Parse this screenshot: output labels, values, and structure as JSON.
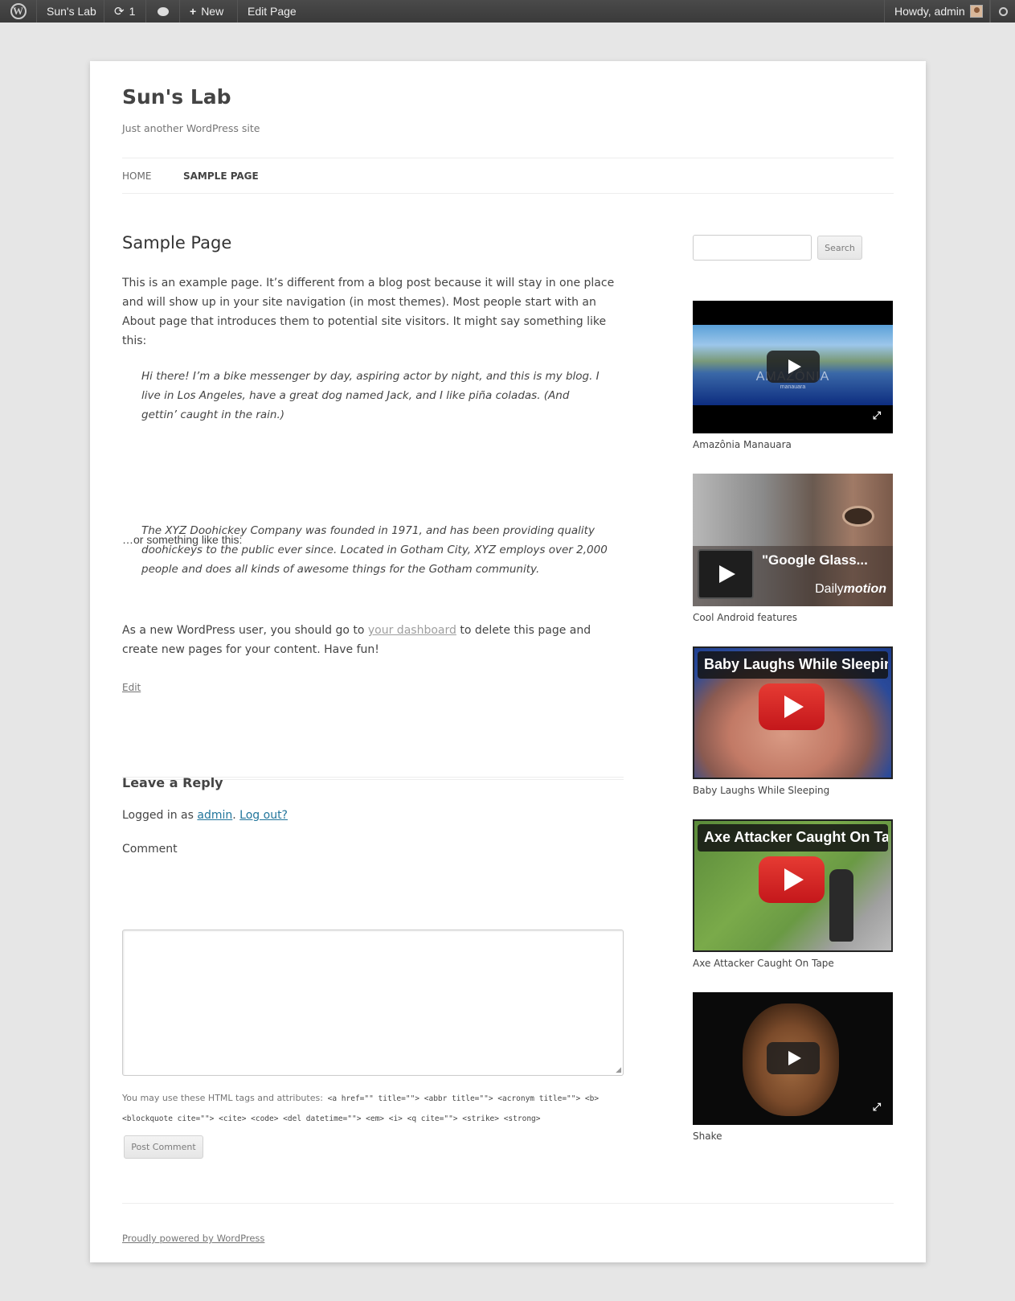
{
  "adminbar": {
    "site_name": "Sun's Lab",
    "updates_count": "1",
    "new_label": "New",
    "edit_label": "Edit Page",
    "howdy": "Howdy, admin"
  },
  "site": {
    "title": "Sun's Lab",
    "description": "Just another WordPress site"
  },
  "nav": {
    "items": [
      {
        "label": "HOME"
      },
      {
        "label": "SAMPLE PAGE"
      }
    ]
  },
  "entry": {
    "title": "Sample Page",
    "p1": "This is an example page. It’s different from a blog post because it will stay in one place and will show up in your site navigation (in most themes). Most people start with an About page that introduces them to potential site visitors. It might say something like this:",
    "quote1": "Hi there! I’m a bike messenger by day, aspiring actor by night, and this is my blog. I live in Los Angeles, have a great dog named Jack, and I like piña coladas. (And gettin’ caught in the rain.)",
    "p2": "…or something like this:",
    "quote2": "The XYZ Doohickey Company was founded in 1971, and has been providing quality doohickeys to the public ever since. Located in Gotham City, XYZ employs over 2,000 people and does all kinds of awesome things for the Gotham community.",
    "p3_before": "As a new WordPress user, you should go to ",
    "p3_link": "your dashboard",
    "p3_after": " to delete this page and create new pages for your content. Have fun!",
    "edit_link": "Edit"
  },
  "reply": {
    "title": "Leave a Reply",
    "logged_prefix": "Logged in as ",
    "user_link": "admin",
    "dot": ".",
    "logout_link": "Log out?",
    "comment_label": "Comment",
    "tags_intro": "You may use these HTML tags and attributes:",
    "tags_line1": " <a href=\"\" title=\"\"> <abbr title=\"\"> <acronym title=\"\"> <b>",
    "tags_line2": "<blockquote cite=\"\"> <cite> <code> <del datetime=\"\"> <em> <i> <q cite=\"\"> <strike> <strong>",
    "submit_label": "Post Comment"
  },
  "sidebar": {
    "search_button": "Search",
    "videos": [
      {
        "caption": "Amazônia Manauara",
        "overlay": "AMAZÔNIA",
        "overlay_sub": "manauara"
      },
      {
        "caption": "Cool Android features",
        "overlay": "\"Google Glass...",
        "brand": "Daily",
        "brand_em": "motion"
      },
      {
        "caption": "Baby Laughs While Sleeping",
        "overlay": "Baby Laughs While Sleeping"
      },
      {
        "caption": "Axe Attacker Caught On Tape",
        "overlay": "Axe Attacker Caught On Tape"
      },
      {
        "caption": "Shake"
      }
    ]
  },
  "footer": {
    "credit": "Proudly powered by WordPress"
  }
}
